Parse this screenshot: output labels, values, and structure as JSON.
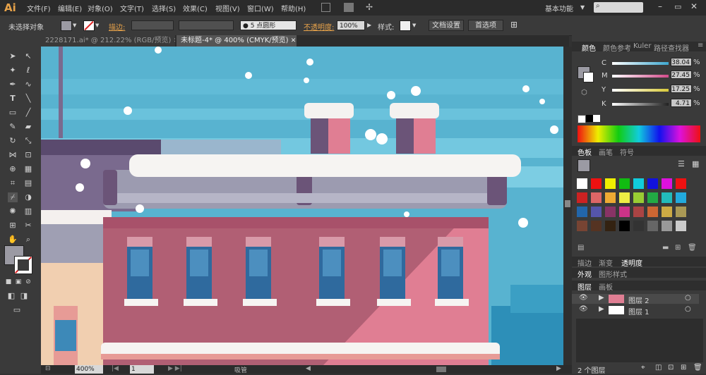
{
  "app": {
    "logo": "Ai",
    "workspace": "基本功能"
  },
  "menu": [
    "文件(F)",
    "编辑(E)",
    "对象(O)",
    "文字(T)",
    "选择(S)",
    "效果(C)",
    "视图(V)",
    "窗口(W)",
    "帮助(H)"
  ],
  "control_bar": {
    "selection_label": "未选择对象",
    "stroke_label": "描边:",
    "brush_label": "5 点圆形",
    "opacity_label": "不透明度:",
    "opacity_value": "100%",
    "style_label": "样式:",
    "doc_setup_button": "文档设置",
    "preferences_button": "首选项"
  },
  "tabs": [
    {
      "label": "2228171.ai* @ 212.22% (RGB/预览)",
      "active": false
    },
    {
      "label": "未标题-4* @ 400% (CMYK/预览)",
      "active": true
    }
  ],
  "status": {
    "zoom": "400%",
    "page": "1",
    "tool": "吸管"
  },
  "color_panel": {
    "tabs": [
      "颜色",
      "颜色参考",
      "Kuler",
      "路径查找器"
    ],
    "channels": [
      {
        "label": "C",
        "value": "38.04",
        "color": "#3ea7cf"
      },
      {
        "label": "M",
        "value": "27.45",
        "color": "#d24a8a"
      },
      {
        "label": "Y",
        "value": "17.25",
        "color": "#d8c93a"
      },
      {
        "label": "K",
        "value": "4.71",
        "color": "#555555"
      }
    ],
    "unit": "%"
  },
  "swatches_panel": {
    "tabs": [
      "色板",
      "画笔",
      "符号"
    ]
  },
  "lower_tabs": [
    "描边",
    "渐变",
    "透明度"
  ],
  "appearance_tabs": [
    "外观",
    "图形样式"
  ],
  "layers_panel": {
    "tabs": [
      "图层",
      "画板"
    ],
    "layers": [
      {
        "name": "图层 2"
      },
      {
        "name": "图层 1"
      }
    ],
    "count": "2 个图层"
  },
  "colors": {
    "accent": "#e8a34a",
    "sky": "#58b3d0",
    "building": "#b15f74"
  }
}
